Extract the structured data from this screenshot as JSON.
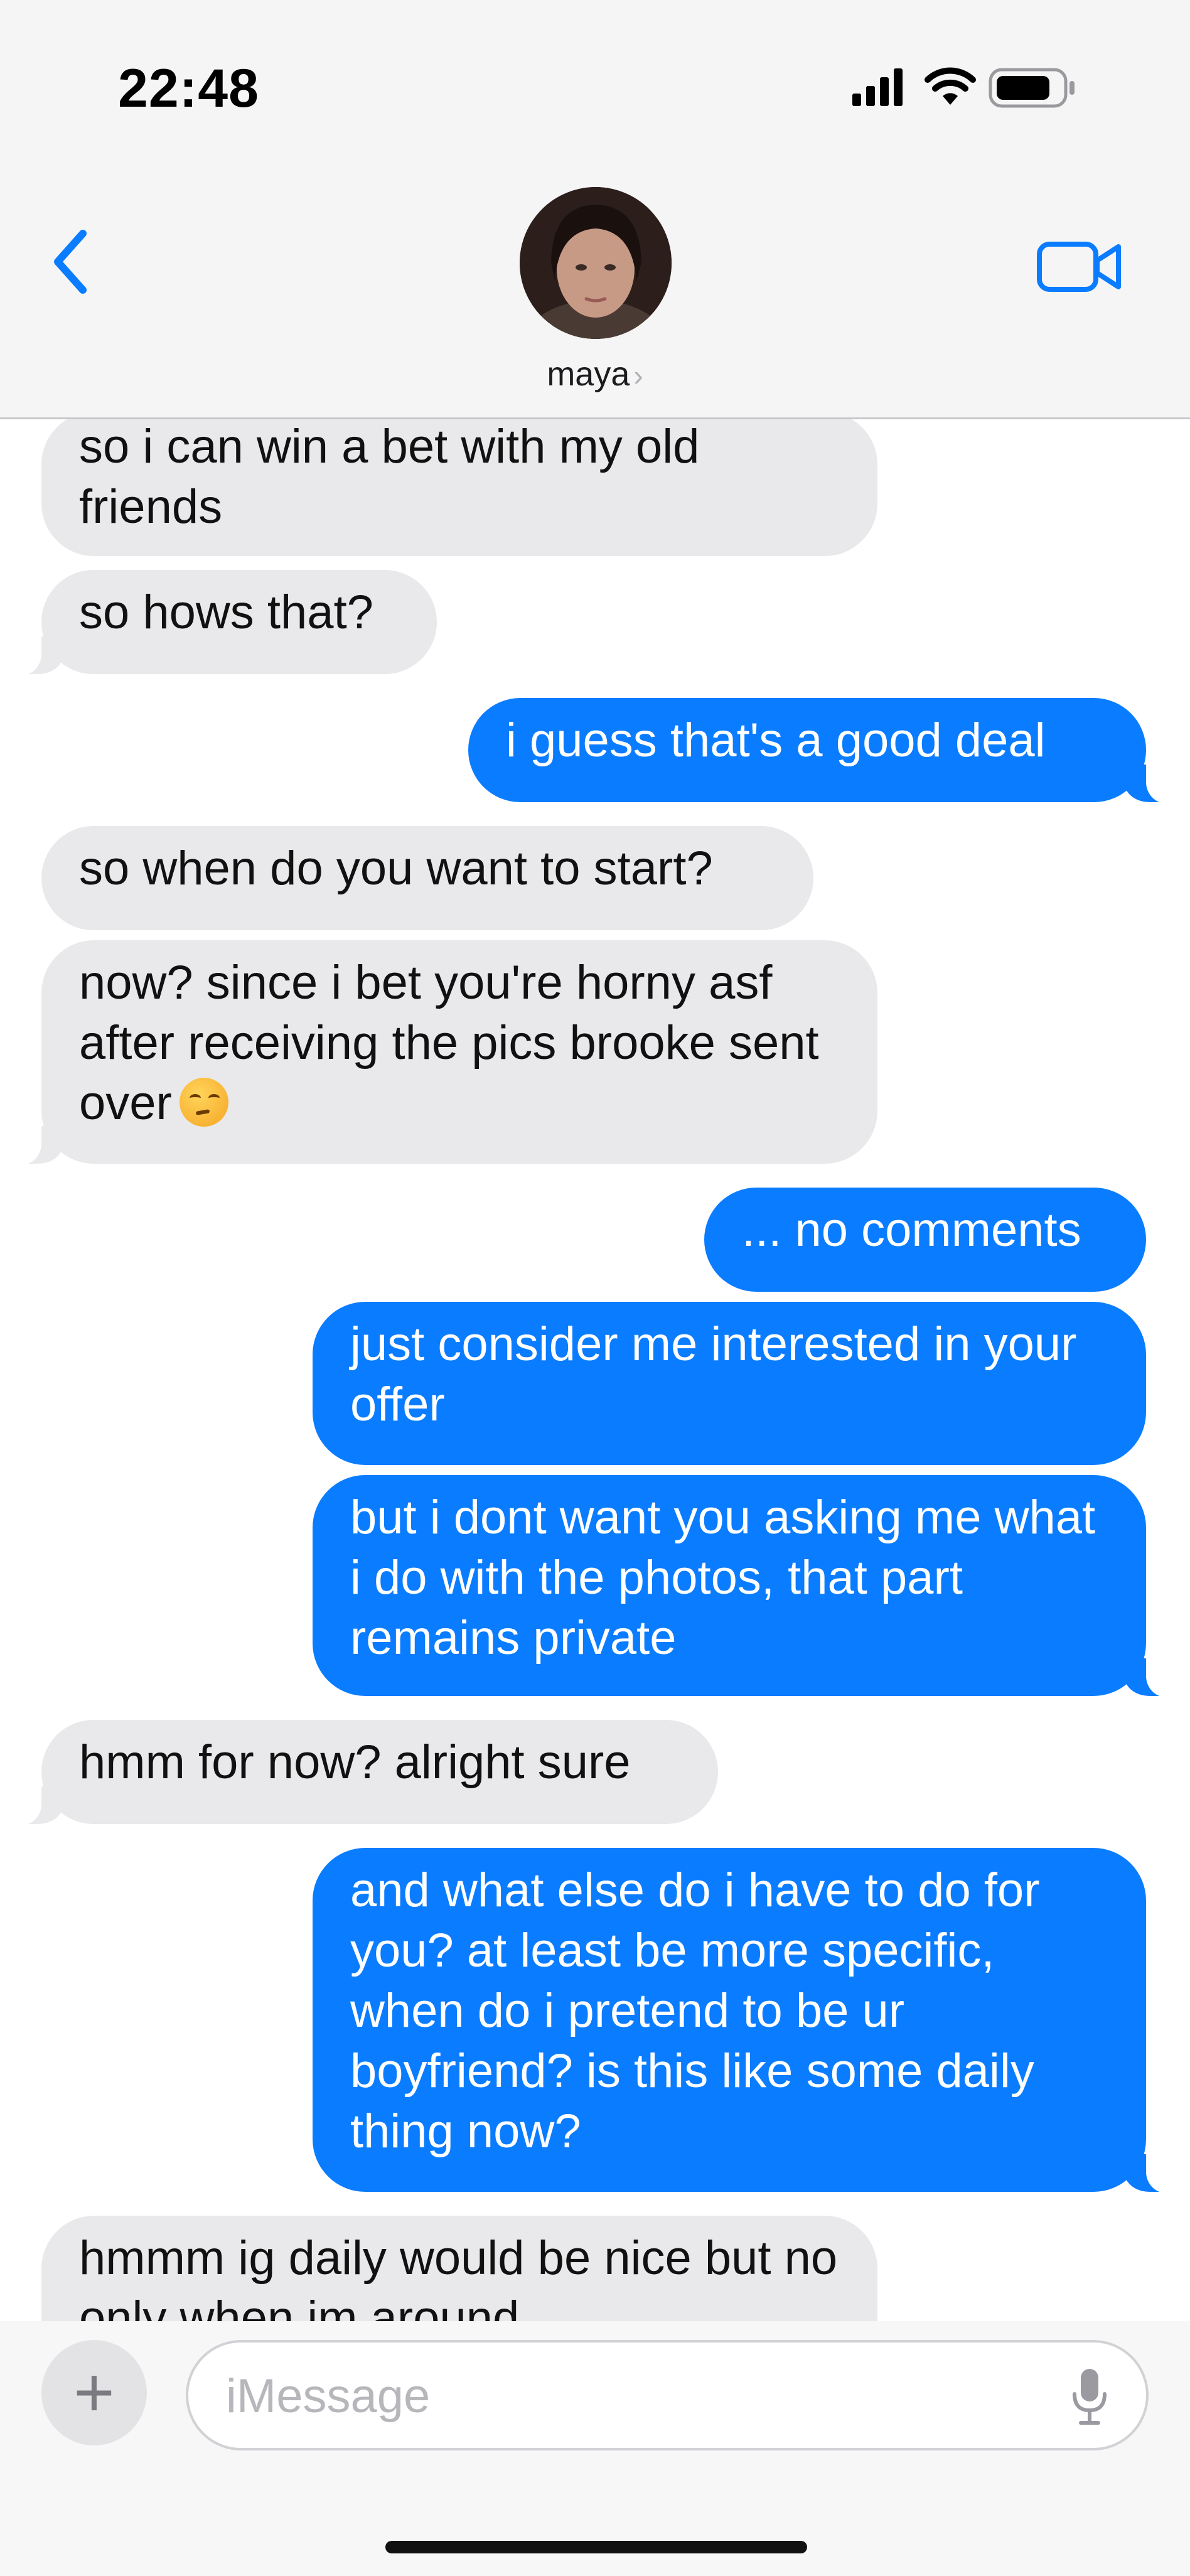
{
  "status_bar": {
    "time": "22:48"
  },
  "header": {
    "contact_name": "maya",
    "back_icon": "chevron-left-icon",
    "video_icon": "video-camera-icon",
    "accent_color": "#0a7cff"
  },
  "messages": [
    {
      "from": "them",
      "text": "so i can win a bet with my old friends"
    },
    {
      "from": "them",
      "text": "so hows that?"
    },
    {
      "from": "me",
      "text": "i guess that's a good deal"
    },
    {
      "from": "them",
      "text": "so when do you want to start?"
    },
    {
      "from": "them",
      "text": "now? since i bet you're horny asf after receiving the pics brooke sent over",
      "emoji": "face-with-rolling-eyes"
    },
    {
      "from": "me",
      "text": "... no comments"
    },
    {
      "from": "me",
      "text": "just consider me interested in your offer"
    },
    {
      "from": "me",
      "text": "but i dont want you asking me what i do with the photos, that part remains private"
    },
    {
      "from": "them",
      "text": "hmm for now? alright sure"
    },
    {
      "from": "me",
      "text": "and what else do i have to do for you? at least be more specific, when do i pretend to be ur boyfriend? is this like some daily thing now?"
    },
    {
      "from": "them",
      "text": "hmmm ig daily would be nice but no only when im around"
    }
  ],
  "composer": {
    "placeholder": "iMessage",
    "plus_label": "+"
  }
}
